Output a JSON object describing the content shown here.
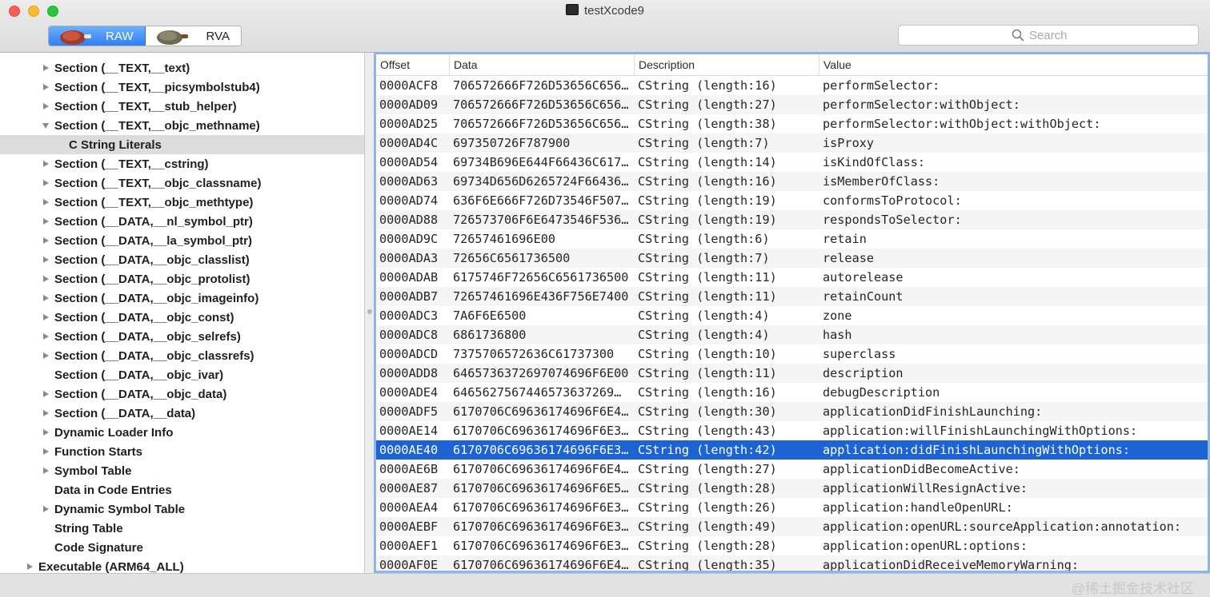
{
  "window": {
    "title": "testXcode9"
  },
  "toolbar": {
    "segments": [
      {
        "label": "RAW",
        "selected": true
      },
      {
        "label": "RVA",
        "selected": false
      }
    ],
    "search": {
      "placeholder": "Search",
      "value": ""
    }
  },
  "sidebar": {
    "items": [
      {
        "label": "Section (__TEXT,__text)",
        "disclosure": "collapsed",
        "depth": 1
      },
      {
        "label": "Section (__TEXT,__picsymbolstub4)",
        "disclosure": "collapsed",
        "depth": 1
      },
      {
        "label": "Section (__TEXT,__stub_helper)",
        "disclosure": "collapsed",
        "depth": 1
      },
      {
        "label": "Section (__TEXT,__objc_methname)",
        "disclosure": "expanded",
        "depth": 1
      },
      {
        "label": "C String Literals",
        "disclosure": "none",
        "depth": 2,
        "selected": true
      },
      {
        "label": "Section (__TEXT,__cstring)",
        "disclosure": "collapsed",
        "depth": 1
      },
      {
        "label": "Section (__TEXT,__objc_classname)",
        "disclosure": "collapsed",
        "depth": 1
      },
      {
        "label": "Section (__TEXT,__objc_methtype)",
        "disclosure": "collapsed",
        "depth": 1
      },
      {
        "label": "Section (__DATA,__nl_symbol_ptr)",
        "disclosure": "collapsed",
        "depth": 1
      },
      {
        "label": "Section (__DATA,__la_symbol_ptr)",
        "disclosure": "collapsed",
        "depth": 1
      },
      {
        "label": "Section (__DATA,__objc_classlist)",
        "disclosure": "collapsed",
        "depth": 1
      },
      {
        "label": "Section (__DATA,__objc_protolist)",
        "disclosure": "collapsed",
        "depth": 1
      },
      {
        "label": "Section (__DATA,__objc_imageinfo)",
        "disclosure": "collapsed",
        "depth": 1
      },
      {
        "label": "Section (__DATA,__objc_const)",
        "disclosure": "collapsed",
        "depth": 1
      },
      {
        "label": "Section (__DATA,__objc_selrefs)",
        "disclosure": "collapsed",
        "depth": 1
      },
      {
        "label": "Section (__DATA,__objc_classrefs)",
        "disclosure": "collapsed",
        "depth": 1
      },
      {
        "label": "Section (__DATA,__objc_ivar)",
        "disclosure": "none",
        "depth": 1
      },
      {
        "label": "Section (__DATA,__objc_data)",
        "disclosure": "collapsed",
        "depth": 1
      },
      {
        "label": "Section (__DATA,__data)",
        "disclosure": "collapsed",
        "depth": 1
      },
      {
        "label": "Dynamic Loader Info",
        "disclosure": "collapsed",
        "depth": 1
      },
      {
        "label": "Function Starts",
        "disclosure": "collapsed",
        "depth": 1
      },
      {
        "label": "Symbol Table",
        "disclosure": "collapsed",
        "depth": 1
      },
      {
        "label": "Data in Code Entries",
        "disclosure": "none",
        "depth": 1
      },
      {
        "label": "Dynamic Symbol Table",
        "disclosure": "collapsed",
        "depth": 1
      },
      {
        "label": "String Table",
        "disclosure": "none",
        "depth": 1
      },
      {
        "label": "Code Signature",
        "disclosure": "none",
        "depth": 1
      },
      {
        "label": "Executable  (ARM64_ALL)",
        "disclosure": "collapsed",
        "depth": 0
      }
    ]
  },
  "table": {
    "columns": [
      "Offset",
      "Data",
      "Description",
      "Value"
    ],
    "rows": [
      [
        "0000ACF8",
        "706572666F726D53656C656…",
        "CString (length:16)",
        "performSelector:"
      ],
      [
        "0000AD09",
        "706572666F726D53656C656…",
        "CString (length:27)",
        "performSelector:withObject:"
      ],
      [
        "0000AD25",
        "706572666F726D53656C656…",
        "CString (length:38)",
        "performSelector:withObject:withObject:"
      ],
      [
        "0000AD4C",
        "697350726F787900",
        "CString (length:7)",
        "isProxy"
      ],
      [
        "0000AD54",
        "69734B696E644F66436C617…",
        "CString (length:14)",
        "isKindOfClass:"
      ],
      [
        "0000AD63",
        "69734D656D6265724F66436…",
        "CString (length:16)",
        "isMemberOfClass:"
      ],
      [
        "0000AD74",
        "636F6E666F726D73546F507…",
        "CString (length:19)",
        "conformsToProtocol:"
      ],
      [
        "0000AD88",
        "726573706F6E6473546F536…",
        "CString (length:19)",
        "respondsToSelector:"
      ],
      [
        "0000AD9C",
        "72657461696E00",
        "CString (length:6)",
        "retain"
      ],
      [
        "0000ADA3",
        "72656C6561736500",
        "CString (length:7)",
        "release"
      ],
      [
        "0000ADAB",
        "6175746F72656C6561736500",
        "CString (length:11)",
        "autorelease"
      ],
      [
        "0000ADB7",
        "72657461696E436F756E7400",
        "CString (length:11)",
        "retainCount"
      ],
      [
        "0000ADC3",
        "7A6F6E6500",
        "CString (length:4)",
        "zone"
      ],
      [
        "0000ADC8",
        "6861736800",
        "CString (length:4)",
        "hash"
      ],
      [
        "0000ADCD",
        "7375706572636C61737300",
        "CString (length:10)",
        "superclass"
      ],
      [
        "0000ADD8",
        "6465736372697074696F6E00",
        "CString (length:11)",
        "description"
      ],
      [
        "0000ADE4",
        "6465627567446573637269…",
        "CString (length:16)",
        "debugDescription"
      ],
      [
        "0000ADF5",
        "6170706C69636174696F6E4…",
        "CString (length:30)",
        "applicationDidFinishLaunching:"
      ],
      [
        "0000AE14",
        "6170706C69636174696F6E3…",
        "CString (length:43)",
        "application:willFinishLaunchingWithOptions:"
      ],
      [
        "0000AE40",
        "6170706C69636174696F6E3…",
        "CString (length:42)",
        "application:didFinishLaunchingWithOptions:"
      ],
      [
        "0000AE6B",
        "6170706C69636174696F6E4…",
        "CString (length:27)",
        "applicationDidBecomeActive:"
      ],
      [
        "0000AE87",
        "6170706C69636174696F6E5…",
        "CString (length:28)",
        "applicationWillResignActive:"
      ],
      [
        "0000AEA4",
        "6170706C69636174696F6E3…",
        "CString (length:26)",
        "application:handleOpenURL:"
      ],
      [
        "0000AEBF",
        "6170706C69636174696F6E3…",
        "CString (length:49)",
        "application:openURL:sourceApplication:annotation:"
      ],
      [
        "0000AEF1",
        "6170706C69636174696F6E3…",
        "CString (length:28)",
        "application:openURL:options:"
      ],
      [
        "0000AF0E",
        "6170706C69636174696F6E4…",
        "CString (length:35)",
        "applicationDidReceiveMemoryWarning:"
      ]
    ],
    "selected_row": 19
  },
  "watermark": "@稀土掘金技术社区",
  "colors": {
    "selection": "#1c64d4",
    "accent": "#2f7ef5",
    "focus_ring": "#8fb4ea"
  }
}
